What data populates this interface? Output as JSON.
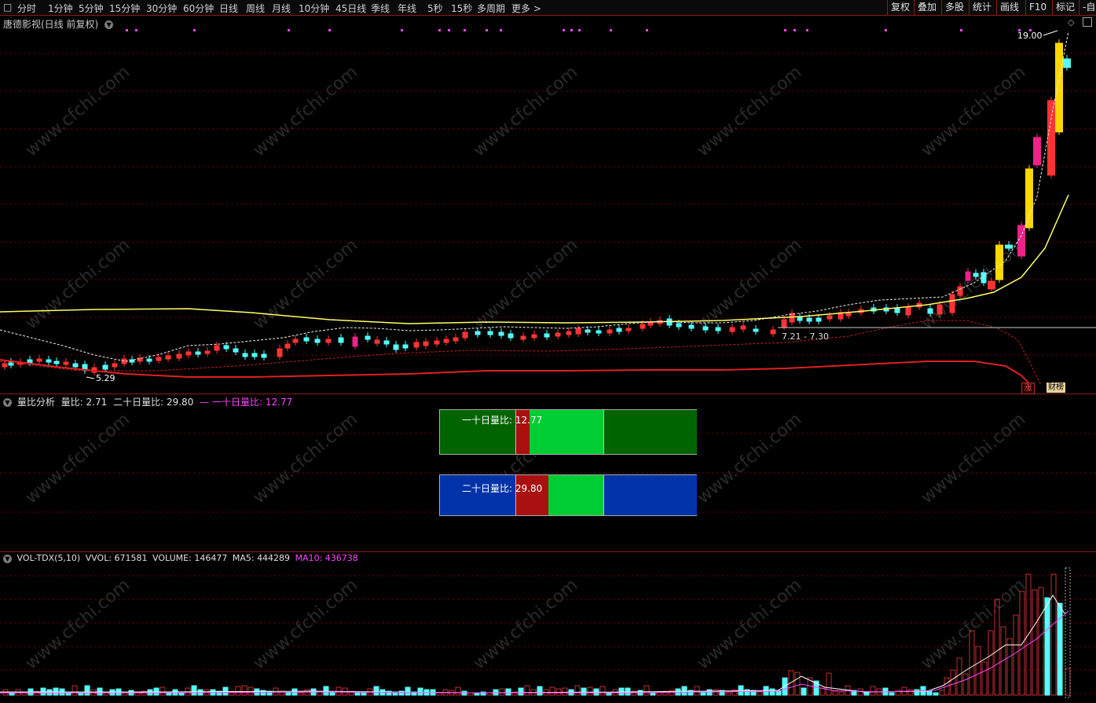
{
  "toolbar": {
    "periods": [
      "分时",
      "1分钟",
      "5分钟",
      "15分钟",
      "30分钟",
      "60分钟",
      "日线",
      "周线",
      "月线",
      "10分钟",
      "45日线",
      "季线",
      "年线",
      "5秒",
      "15秒",
      "多周期",
      "更多 >"
    ],
    "right_buttons": [
      "复权",
      "叠加",
      "多股",
      "统计",
      "画线",
      "F10",
      "标记",
      "-自"
    ]
  },
  "main_chart": {
    "title": "唐德影视(日线 前复权)",
    "high_label": "19.00",
    "low_label": "5.29",
    "range_label": "7.21 - 7.30",
    "badges": [
      "涨",
      "财榜"
    ]
  },
  "ratio_panel": {
    "indicator_name": "量比分析",
    "liangbi_label": "量比:",
    "liangbi_value": "2.71",
    "ma20_label": "二十日量比:",
    "ma20_value": "29.80",
    "ma10_label": "一十日量比:",
    "ma10_value": "12.77",
    "box1_text": "一十日量比: 12.77",
    "box2_text": "二十日量比: 29.80"
  },
  "volume_panel": {
    "indicator_name": "VOL-TDX(5,10)",
    "vvol_label": "VVOL:",
    "vvol_value": "671581",
    "volume_label": "VOLUME:",
    "volume_value": "146477",
    "ma5_label": "MA5:",
    "ma5_value": "444289",
    "ma10_label": "MA10:",
    "ma10_value": "436738"
  },
  "colors": {
    "up": "#ff3333",
    "down": "#54ffff",
    "ma_yellow": "#ffff66",
    "ma_red": "#e02020",
    "magenta": "#ff44ff",
    "grid": "#5a0000"
  },
  "watermark": "www.cfchi.com"
}
